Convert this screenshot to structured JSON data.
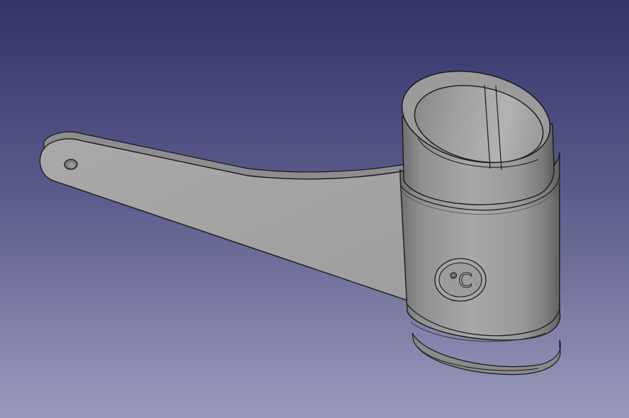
{
  "viewport": {
    "background_top": "#33346a",
    "background_bottom": "#9a9abc"
  },
  "model": {
    "body_color": "#a3a3a3",
    "edge_color": "#1a1a1a",
    "emboss_glyph": "°C"
  }
}
